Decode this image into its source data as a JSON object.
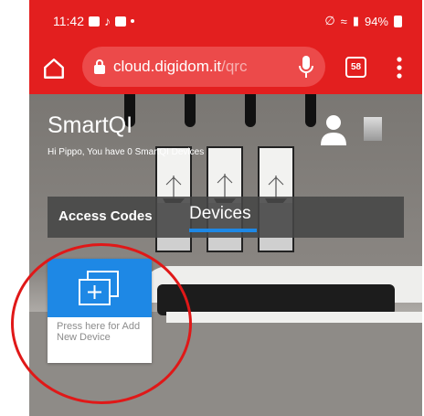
{
  "status_bar": {
    "time": "11:42",
    "battery": "94%"
  },
  "browser": {
    "url_domain": "cloud.digidom.it",
    "url_path": "/qrc",
    "tab_count": "58"
  },
  "app": {
    "title": "SmartQI",
    "subtitle": "Hi Pippo, You have 0 SmartQI Devices"
  },
  "tabs": [
    {
      "label": "Access Codes",
      "active": false
    },
    {
      "label": "Devices",
      "active": true
    }
  ],
  "add_device": {
    "label": "Press here for Add New Device"
  },
  "colors": {
    "browser_red": "#e31f1f",
    "accent_blue": "#1e88e5",
    "annotation_red": "#e01818"
  }
}
